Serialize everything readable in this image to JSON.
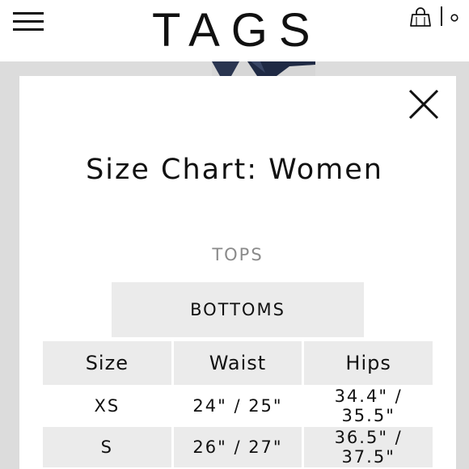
{
  "header": {
    "logo": "TAGS",
    "menu_icon": "hamburger-menu-icon",
    "cart_icon": "shopping-bag-icon",
    "account_icon": "account-icon"
  },
  "modal": {
    "title": "Size Chart: Women",
    "close_icon": "close-icon",
    "tabs": [
      {
        "label": "TOPS",
        "active": false
      },
      {
        "label": "BOTTOMS",
        "active": true
      }
    ],
    "table": {
      "headers": [
        "Size",
        "Waist",
        "Hips"
      ],
      "rows": [
        [
          "XS",
          "24\" / 25\"",
          "34.4\" / 35.5\""
        ],
        [
          "S",
          "26\" / 27\"",
          "36.5\" / 37.5\""
        ]
      ]
    }
  },
  "colors": {
    "backdrop": "#dcdcdc",
    "header_cell": "#ebebeb",
    "inactive_tab_text": "#8a8a8a",
    "text": "#111111"
  }
}
